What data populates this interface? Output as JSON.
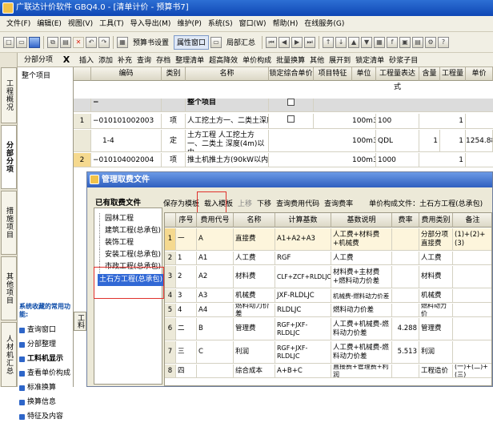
{
  "window": {
    "title": "广联达计价软件 GBQ4.0 - [清单计价 - 预算书7]"
  },
  "menu": [
    "文件(F)",
    "编辑(E)",
    "视图(V)",
    "工具(T)",
    "导入导出(M)",
    "维护(P)",
    "系统(S)",
    "窗口(W)",
    "帮助(H)",
    "在线服务(G)"
  ],
  "toolbar1": {
    "budget_setting": "预算书设置",
    "prop_window": "属性窗口",
    "partial_summary": "局部汇总"
  },
  "side_tabs": [
    "工程概况",
    "分部分项",
    "措施项目",
    "其他项目",
    "人材机汇总"
  ],
  "left_pane": {
    "header": "分部分项",
    "close": "X",
    "root": "整个项目",
    "fav_title": "系统收藏的常用功能:",
    "favorites": [
      "查询窗口",
      "分部整理",
      "工料机显示",
      "查看单价构成",
      "标准换算",
      "换算信息",
      "特征及内容"
    ]
  },
  "toolbar2": [
    "插入",
    "添加",
    "补充",
    "查询",
    "存档",
    "整理清单",
    "超高降效",
    "单价构成",
    "批量换算",
    "其他",
    "展开到",
    "锁定清单",
    "砂浆子目"
  ],
  "grid": {
    "headers": [
      "",
      "编码",
      "类别",
      "名称",
      "锁定综合单价",
      "项目特征",
      "单位",
      "工程量表达式",
      "含量",
      "工程量",
      "单价"
    ],
    "rows": [
      {
        "rownum": "",
        "code": "−",
        "type": "",
        "name": "整个项目",
        "unit": "",
        "expr": "",
        "content": "",
        "qty": "",
        "price": ""
      },
      {
        "rownum": "1",
        "code": "−010101002003",
        "type": "项",
        "name": "人工挖土方一、二类土深度4m以内",
        "unit": "100m3",
        "expr": "100",
        "content": "",
        "qty": "1",
        "price": ""
      },
      {
        "rownum": "",
        "code": "1-4",
        "type": "定",
        "name": "土方工程 人工挖土方 一、二类土 深度(4m)以内",
        "unit": "100m3",
        "expr": "QDL",
        "content": "1",
        "qty": "1",
        "price": "1254.88"
      },
      {
        "rownum": "2",
        "code": "−010104002004",
        "type": "项",
        "name": "推土机推土方(90kW以内)运距20m以内",
        "unit": "100m3",
        "expr": "1000",
        "content": "",
        "qty": "1",
        "price": ""
      }
    ]
  },
  "dialog": {
    "title": "管理取费文件",
    "list_title": "已有取费文件",
    "list": [
      "园林工程",
      "建筑工程(总承包)",
      "装饰工程",
      "安装工程(总承包)",
      "市政工程(总承包)",
      "土石方工程(总承包)"
    ],
    "toolbar": [
      "保存为模板",
      "载入模板",
      "上移",
      "下移",
      "查询费用代码",
      "查询费率"
    ],
    "current_label": "单价构成文件：土石方工程(总承包)",
    "headers": [
      "",
      "序号",
      "费用代号",
      "名称",
      "计算基数",
      "基数说明",
      "费率(%)",
      "费用类别",
      "备注"
    ],
    "rows": [
      {
        "n": "1",
        "seq": "一",
        "code": "A",
        "name": "直接费",
        "base": "A1+A2+A3",
        "desc": "人工费+材料费+机械费",
        "rate": "",
        "cat": "分部分项直接费",
        "note": "(1)+(2)+(3)"
      },
      {
        "n": "2",
        "seq": "1",
        "code": "A1",
        "name": "人工费",
        "base": "RGF",
        "desc": "人工费",
        "rate": "",
        "cat": "人工费",
        "note": ""
      },
      {
        "n": "3",
        "seq": "2",
        "code": "A2",
        "name": "材料费",
        "base": "CLF+ZCF+RLDLJC",
        "desc": "材料费+主材费+燃料动力价差",
        "rate": "",
        "cat": "材料费",
        "note": ""
      },
      {
        "n": "4",
        "seq": "3",
        "code": "A3",
        "name": "机械费",
        "base": "JXF-RLDLJC",
        "desc": "机械费-燃料动力价差",
        "rate": "",
        "cat": "机械费",
        "note": ""
      },
      {
        "n": "5",
        "seq": "4",
        "code": "A4",
        "name": "燃料动力价差",
        "base": "RLDLJC",
        "desc": "燃料动力价差",
        "rate": "",
        "cat": "燃料动力价",
        "note": ""
      },
      {
        "n": "6",
        "seq": "二",
        "code": "B",
        "name": "管理费",
        "base": "RGF+JXF-RLDLJC",
        "desc": "人工费+机械费-燃料动力价差",
        "rate": "4.288",
        "cat": "管理费",
        "note": ""
      },
      {
        "n": "7",
        "seq": "三",
        "code": "C",
        "name": "利润",
        "base": "RGF+JXF-RLDLJC",
        "desc": "人工费+机械费-燃料动力价差",
        "rate": "5.513",
        "cat": "利润",
        "note": ""
      },
      {
        "n": "8",
        "seq": "四",
        "code": "",
        "name": "综合成本",
        "base": "A+B+C",
        "desc": "直接费+管理费+利润",
        "rate": "",
        "cat": "工程造价",
        "note": "(一)+(二)+(三)"
      }
    ]
  },
  "bottom_tab": "工料"
}
